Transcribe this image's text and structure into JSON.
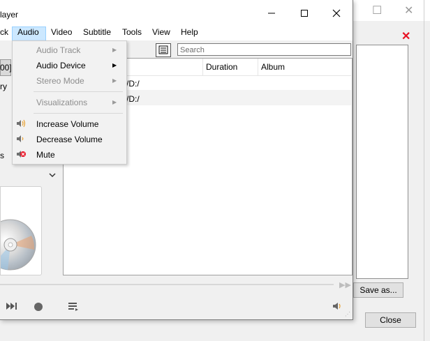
{
  "background_dialog": {
    "buttons": {
      "save": "Save as...",
      "close": "Close"
    },
    "controls": {
      "maximize_icon": "maximize-icon",
      "close_icon": "close-icon",
      "delete_icon": "red-x-icon"
    }
  },
  "window": {
    "title": "layer",
    "controls": {
      "minimize": "minimize-icon",
      "maximize": "maximize-icon",
      "close": "close-icon"
    }
  },
  "menubar": {
    "items": [
      {
        "label": "ck"
      },
      {
        "label": "Audio",
        "active": true
      },
      {
        "label": "Video"
      },
      {
        "label": "Subtitle"
      },
      {
        "label": "Tools"
      },
      {
        "label": "View"
      },
      {
        "label": "Help"
      }
    ]
  },
  "audio_menu": {
    "items": [
      {
        "label": "Audio Track",
        "enabled": false,
        "submenu": true
      },
      {
        "label": "Audio Device",
        "enabled": true,
        "submenu": true
      },
      {
        "label": "Stereo Mode",
        "enabled": false,
        "submenu": true
      },
      {
        "label": "Visualizations",
        "enabled": false,
        "submenu": true
      },
      {
        "label": "Increase Volume",
        "enabled": true,
        "icon": "volume-up-icon"
      },
      {
        "label": "Decrease Volume",
        "enabled": true,
        "icon": "volume-down-icon"
      },
      {
        "label": "Mute",
        "enabled": true,
        "icon": "mute-icon"
      }
    ]
  },
  "sidebar": {
    "items": [
      "00]",
      "ry",
      "s"
    ],
    "chevron_icon": "chevron-down-icon"
  },
  "playlist": {
    "search_placeholder": "Search",
    "columns": [
      "Duration",
      "Album"
    ],
    "rows": [
      {
        "location": "/D:/"
      },
      {
        "location": "/D:/"
      }
    ]
  },
  "controls": {
    "next_icon": "next-icon",
    "stop_icon": "stop-icon",
    "playlist_icon": "playlist-icon",
    "volume_icon": "volume-icon"
  }
}
